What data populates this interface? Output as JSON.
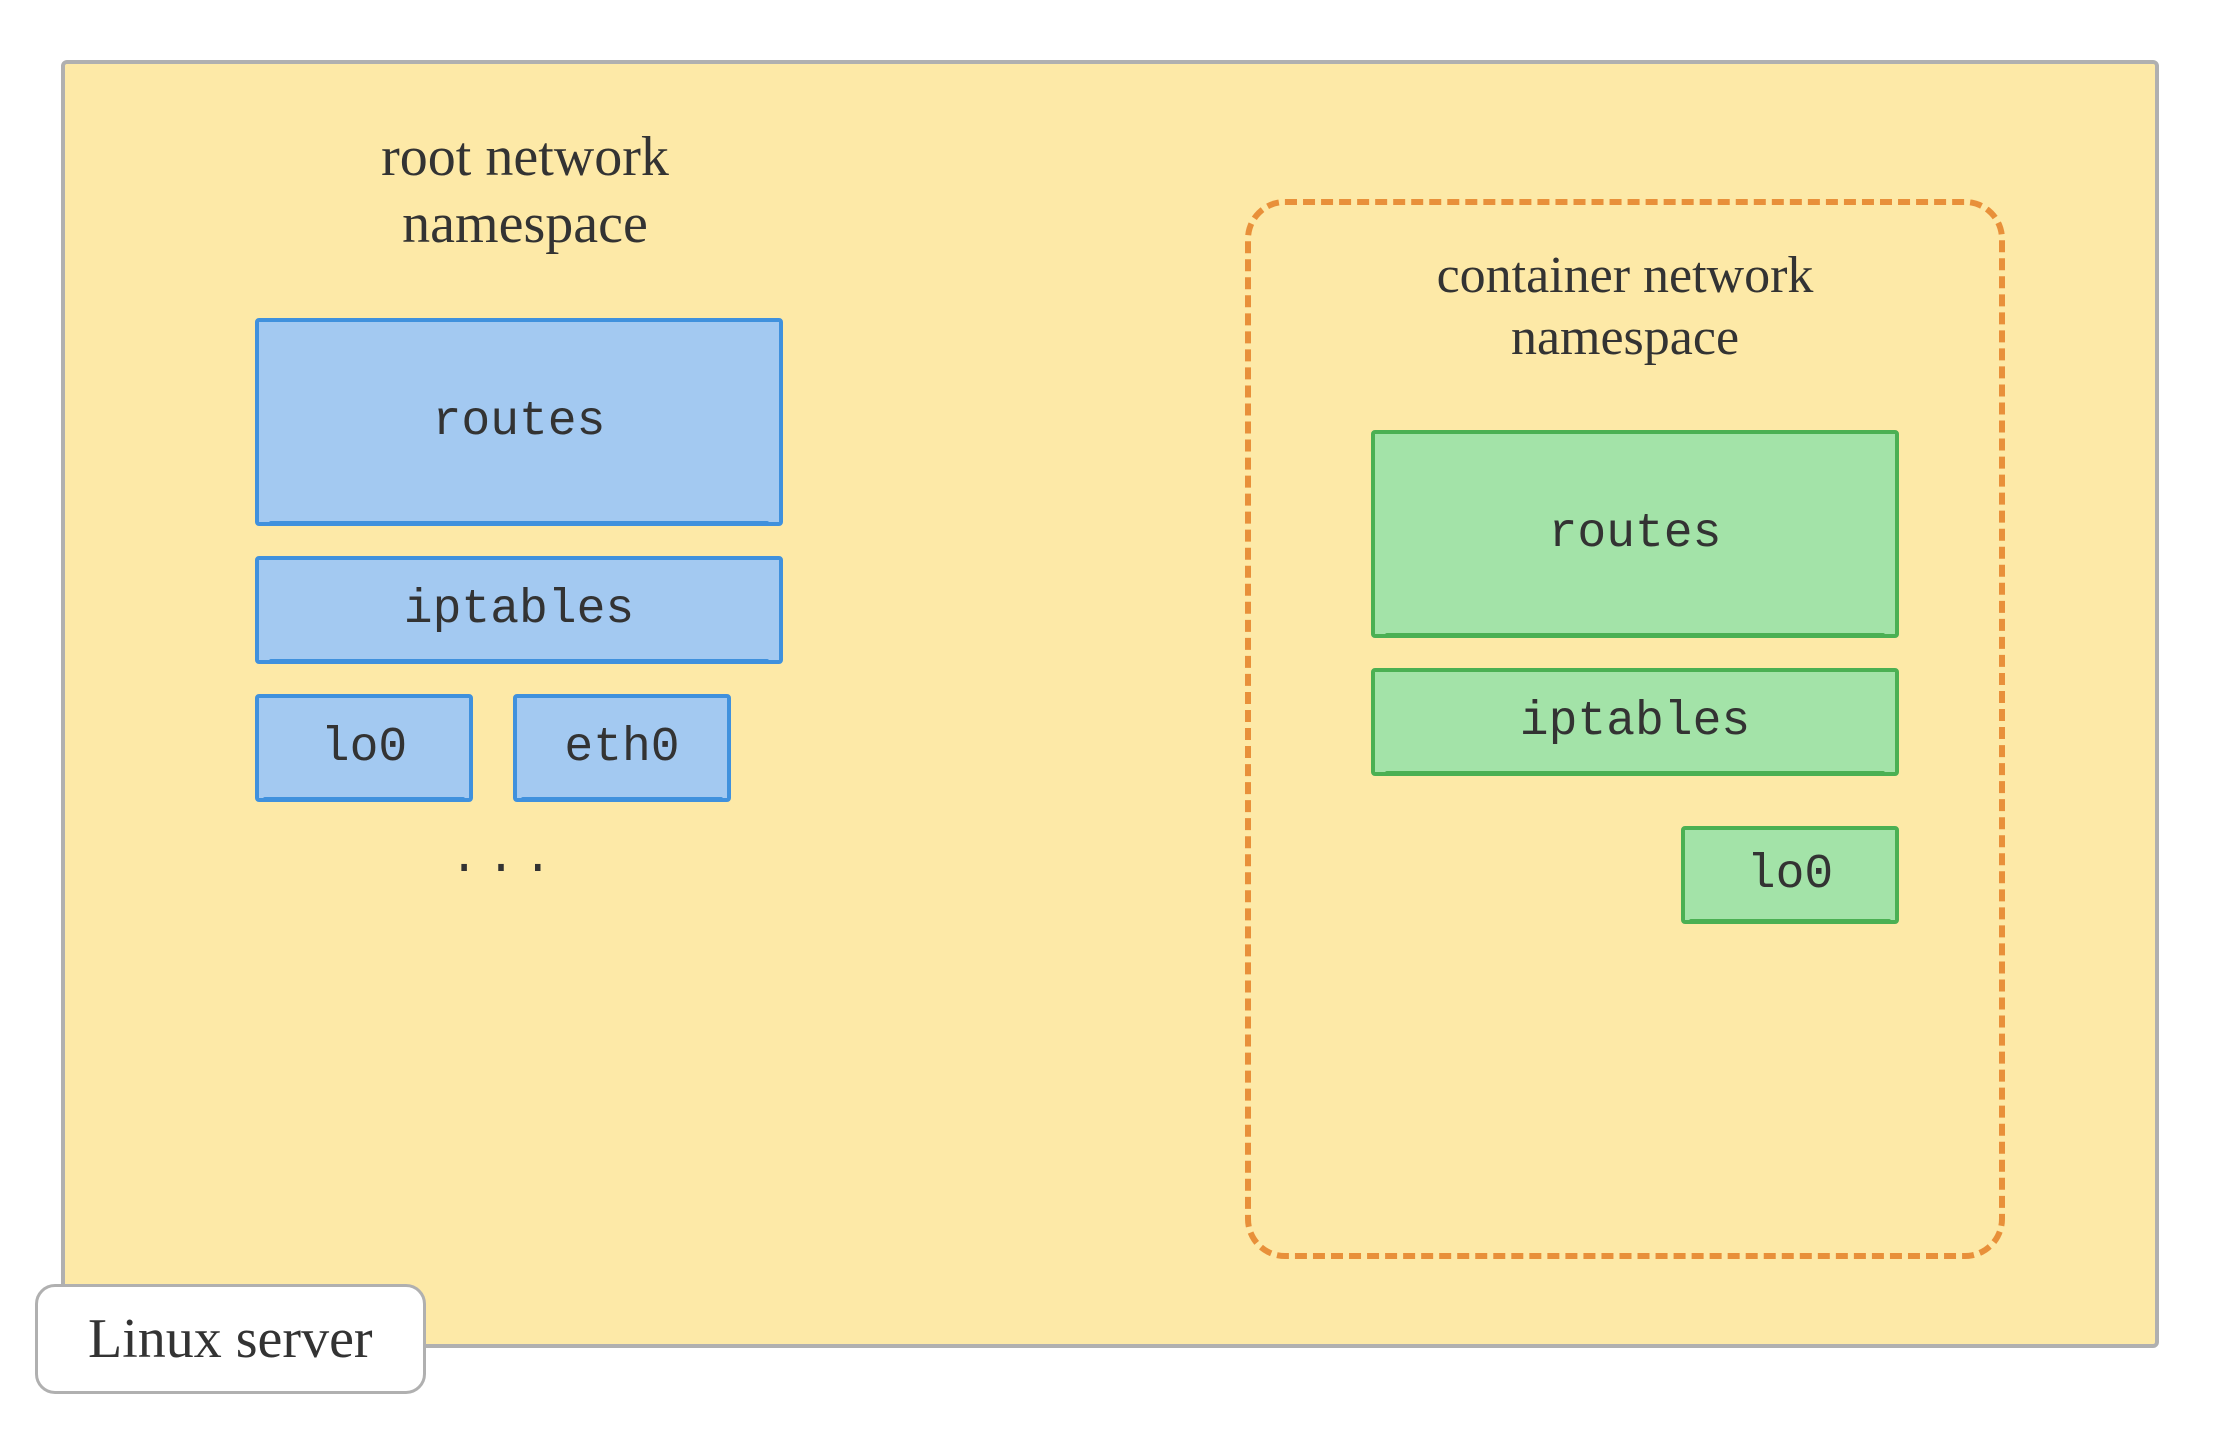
{
  "server": {
    "label": "Linux server"
  },
  "root_namespace": {
    "title_line1": "root network",
    "title_line2": "namespace",
    "routes": "routes",
    "iptables": "iptables",
    "interfaces": {
      "if1": "lo0",
      "if2": "eth0"
    },
    "ellipsis": "..."
  },
  "container_namespace": {
    "title_line1": "container network",
    "title_line2": "namespace",
    "routes": "routes",
    "iptables": "iptables",
    "interfaces": {
      "if1": "lo0"
    }
  }
}
